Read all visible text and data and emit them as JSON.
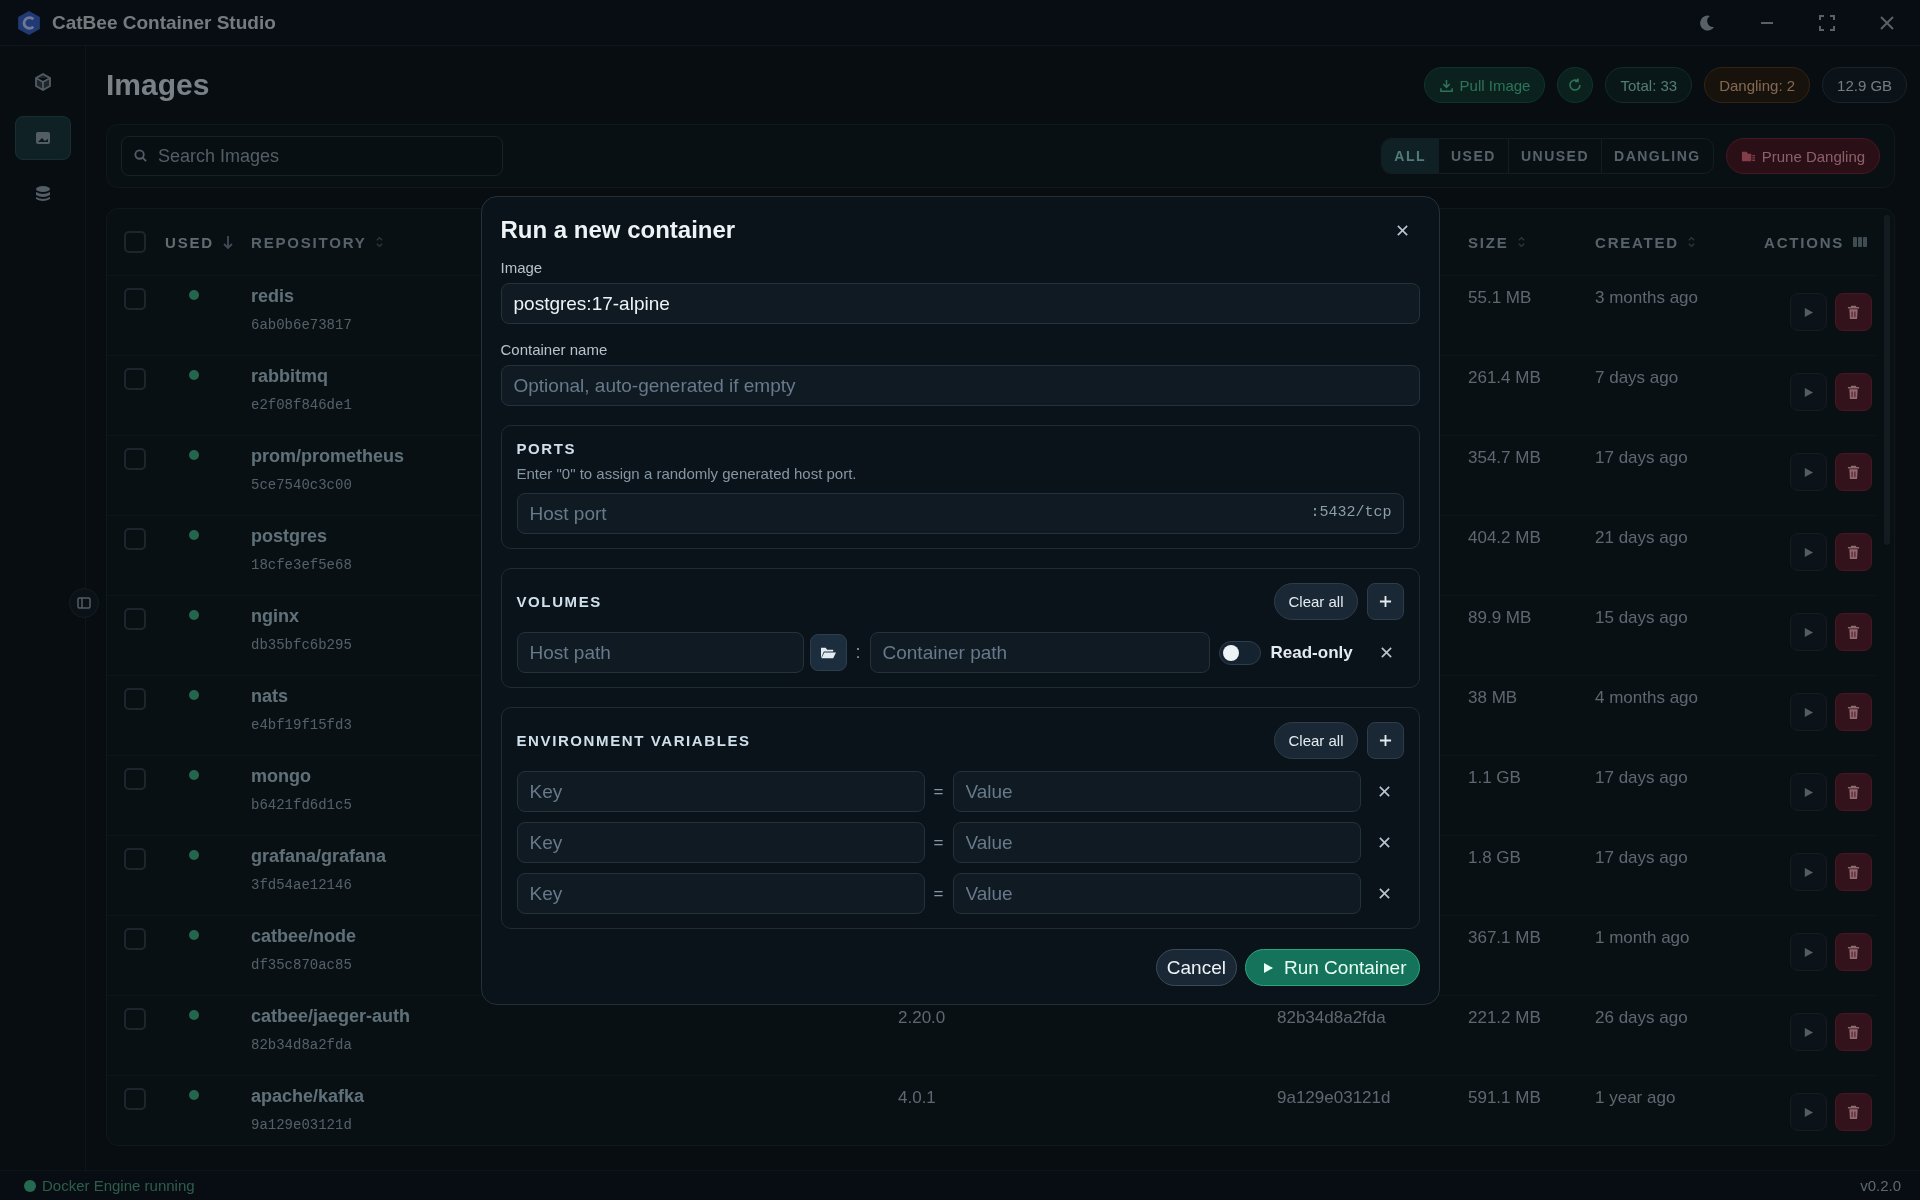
{
  "window": {
    "title": "CatBee Container Studio"
  },
  "sidebar": {
    "items": [
      {
        "kind": "cube",
        "selected": false
      },
      {
        "kind": "image",
        "selected": true
      },
      {
        "kind": "database",
        "selected": false
      }
    ]
  },
  "page": {
    "title": "Images",
    "pull_button": "Pull Image",
    "stats": [
      {
        "text": "Total: 33",
        "kind": "total"
      },
      {
        "text": "Dangling: 2",
        "kind": "warning"
      },
      {
        "text": "12.9 GB",
        "kind": "size"
      }
    ]
  },
  "search": {
    "placeholder": "Search Images"
  },
  "filters": [
    {
      "label": "ALL",
      "selected": true
    },
    {
      "label": "USED",
      "selected": false
    },
    {
      "label": "UNUSED",
      "selected": false
    },
    {
      "label": "DANGLING",
      "selected": false
    }
  ],
  "prune_button": "Prune Dangling",
  "table": {
    "select_all": false,
    "columns": [
      {
        "label": "USED",
        "kind": "sorted"
      },
      {
        "label": "REPOSITORY",
        "kind": "sortable"
      },
      {
        "label": "SIZE",
        "kind": "sortable"
      },
      {
        "label": "CREATED",
        "kind": "sortable"
      },
      {
        "label": "ACTIONS",
        "kind": "settings"
      }
    ],
    "rows": [
      {
        "checked": false,
        "used": true,
        "repository": "redis",
        "id": "6ab0b6e73817",
        "size": "55.1 MB",
        "created": "3 months ago"
      },
      {
        "checked": false,
        "used": true,
        "repository": "rabbitmq",
        "id": "e2f08f846de1",
        "size": "261.4 MB",
        "created": "7 days ago"
      },
      {
        "checked": false,
        "used": true,
        "repository": "prom/prometheus",
        "id": "5ce7540c3c00",
        "size": "354.7 MB",
        "created": "17 days ago"
      },
      {
        "checked": false,
        "used": true,
        "repository": "postgres",
        "id": "18cfe3ef5e68",
        "size": "404.2 MB",
        "created": "21 days ago"
      },
      {
        "checked": false,
        "used": true,
        "repository": "nginx",
        "id": "db35bfc6b295",
        "size": "89.9 MB",
        "created": "15 days ago"
      },
      {
        "checked": false,
        "used": true,
        "repository": "nats",
        "id": "e4bf19f15fd3",
        "size": "38 MB",
        "created": "4 months ago"
      },
      {
        "checked": false,
        "used": true,
        "repository": "mongo",
        "id": "b6421fd6d1c5",
        "size": "1.1 GB",
        "created": "17 days ago"
      },
      {
        "checked": false,
        "used": true,
        "repository": "grafana/grafana",
        "id": "3fd54ae12146",
        "size": "1.8 GB",
        "created": "17 days ago"
      },
      {
        "checked": false,
        "used": true,
        "repository": "catbee/node",
        "id": "df35c870ac85",
        "size": "367.1 MB",
        "created": "1 month ago"
      },
      {
        "checked": false,
        "used": true,
        "repository": "catbee/jaeger-auth",
        "id": "82b34d8a2fda",
        "column_3": "2.20.0",
        "column_4": "82b34d8a2fda",
        "size": "221.2 MB",
        "created": "26 days ago"
      },
      {
        "checked": false,
        "used": true,
        "repository": "apache/kafka",
        "id": "9a129e03121d",
        "column_3": "4.0.1",
        "column_4": "9a129e03121d",
        "size": "591.1 MB",
        "created": "1 year ago"
      }
    ]
  },
  "status_bar": {
    "engine": "Docker Engine running",
    "running": true,
    "version": "v0.2.0"
  },
  "modal": {
    "title": "Run a new container",
    "image": {
      "label": "Image",
      "value": "postgres:17-alpine"
    },
    "name": {
      "label": "Container name",
      "placeholder": "Optional, auto-generated if empty"
    },
    "ports": {
      "title": "PORTS",
      "hint": "Enter \"0\" to assign a randomly generated host port.",
      "rows": [
        {
          "placeholder": "Host port",
          "suffix": ":5432/tcp"
        }
      ]
    },
    "volumes": {
      "title": "VOLUMES",
      "clear": "Clear all",
      "rows": [
        {
          "host_placeholder": "Host path",
          "separator": ":",
          "container_placeholder": "Container path",
          "read_only": false,
          "read_only_label": "Read-only"
        }
      ]
    },
    "env": {
      "title": "ENVIRONMENT VARIABLES",
      "clear": "Clear all",
      "rows": [
        {
          "key_placeholder": "Key",
          "separator": "=",
          "value_placeholder": "Value"
        },
        {
          "key_placeholder": "Key",
          "separator": "=",
          "value_placeholder": "Value"
        },
        {
          "key_placeholder": "Key",
          "separator": "=",
          "value_placeholder": "Value"
        }
      ]
    },
    "cancel": "Cancel",
    "run": "Run Container"
  }
}
